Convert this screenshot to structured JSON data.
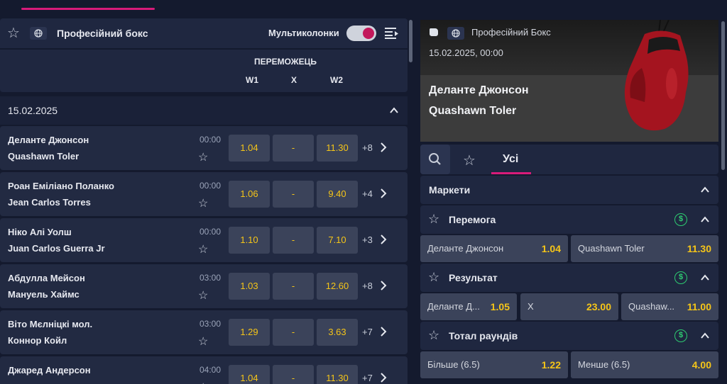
{
  "left": {
    "header": {
      "title": "Професійний бокс",
      "multicolumn_label": "Мультиколонки"
    },
    "market_header": "ПЕРЕМОЖЕЦЬ",
    "columns": [
      "W1",
      "X",
      "W2"
    ],
    "date": "15.02.2025",
    "events": [
      {
        "p1": "Деланте Джонсон",
        "p2": "Quashawn Toler",
        "time": "00:00",
        "w1": "1.04",
        "x": "-",
        "w2": "11.30",
        "more": "+8"
      },
      {
        "p1": "Роан Еміліано Поланко",
        "p2": "Jean Carlos Torres",
        "time": "00:00",
        "w1": "1.06",
        "x": "-",
        "w2": "9.40",
        "more": "+4"
      },
      {
        "p1": "Ніко Алі Уолш",
        "p2": "Juan Carlos Guerra Jr",
        "time": "00:00",
        "w1": "1.10",
        "x": "-",
        "w2": "7.10",
        "more": "+3"
      },
      {
        "p1": "Абдулла Мейсон",
        "p2": "Мануель Хаймс",
        "time": "03:00",
        "w1": "1.03",
        "x": "-",
        "w2": "12.60",
        "more": "+8"
      },
      {
        "p1": "Віто Мєлніцкі мол.",
        "p2": "Коннор Койл",
        "time": "03:00",
        "w1": "1.29",
        "x": "-",
        "w2": "3.63",
        "more": "+7"
      },
      {
        "p1": "Джаред Андерсон",
        "p2": "",
        "time": "04:00",
        "w1": "1.04",
        "x": "-",
        "w2": "11.30",
        "more": "+7"
      }
    ]
  },
  "right": {
    "sport": "Професійний Бокс",
    "datetime": "15.02.2025, 00:00",
    "team1": "Деланте Джонсон",
    "team2": "Quashawn Toler",
    "tab_all": "Усі",
    "markets_label": "Маркети",
    "win": {
      "label": "Перемога",
      "o1_name": "Деланте Джонсон",
      "o1": "1.04",
      "o2_name": "Quashawn Toler",
      "o2": "11.30"
    },
    "result": {
      "label": "Результат",
      "o1_name": "Деланте Д...",
      "o1": "1.05",
      "ox_name": "X",
      "ox": "23.00",
      "o2_name": "Quashaw...",
      "o2": "11.00"
    },
    "rounds": {
      "label": "Тотал раундів",
      "over_name": "Більше (6.5)",
      "over": "1.22",
      "under_name": "Менше (6.5)",
      "under": "4.00"
    }
  },
  "colors": {
    "accent": "#d81b7a",
    "odds": "#f5c518",
    "money": "#2ecc71"
  }
}
